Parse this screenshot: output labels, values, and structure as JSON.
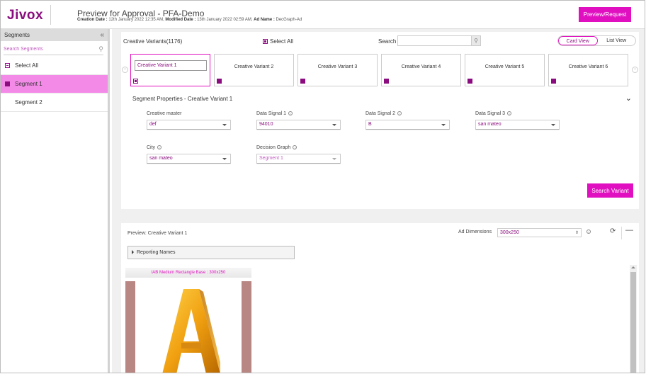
{
  "header": {
    "logo": "Jivox",
    "title": "Preview for Approval - PFA-Demo",
    "creation_label": "Creation Date :",
    "creation_value": "12th January 2022 12:35 AM,",
    "modified_label": "Modified Date :",
    "modified_value": "13th January 2022 02:59 AM,",
    "adname_label": "Ad Name :",
    "adname_value": "DecGraph-Ad",
    "preview_request_label": "Preview/Request"
  },
  "sidebar": {
    "title": "Segments",
    "collapse_icon": "«",
    "search_placeholder": "Search Segments",
    "items": [
      {
        "label": "Select All"
      },
      {
        "label": "Segment 1"
      },
      {
        "label": "Segment 2"
      }
    ]
  },
  "variants": {
    "title": "Creative Variants(1176)",
    "select_all_label": "Select All",
    "search_label": "Search",
    "search_value": "",
    "card_view_label": "Card View",
    "list_view_label": "List View",
    "prev_icon": "‹",
    "next_icon": "›",
    "cards": [
      {
        "label": "Creative Variant 1"
      },
      {
        "label": "Creative Variant 2"
      },
      {
        "label": "Creative Variant 3"
      },
      {
        "label": "Creative Variant 4"
      },
      {
        "label": "Creative Variant 5"
      },
      {
        "label": "Creative Variant 6"
      }
    ]
  },
  "properties": {
    "title": "Segment Properties  - Creative Variant 1",
    "chevron_icon": "⌄",
    "info_icon": "i",
    "fields": [
      {
        "label": "Creative master",
        "value": "def"
      },
      {
        "label": "Data Signal 1",
        "value": "94010"
      },
      {
        "label": "Data Signal 2",
        "value": "B"
      },
      {
        "label": "Data Signal 3",
        "value": "san mateo"
      },
      {
        "label": "City",
        "value": "san mateo"
      },
      {
        "label": "Decision Graph",
        "value": "Segment 1"
      }
    ],
    "search_variant_label": "Search Variant"
  },
  "preview": {
    "title": "Preview: Creative Variant 1",
    "ad_dimensions_label": "Ad Dimensions",
    "ad_dimensions_value": "300x250",
    "updown_icon": "⇕",
    "refresh_icon": "⟳",
    "minimize_icon": "—",
    "reporting_label": "Reporting Names",
    "ad_title": "IAB Medium Rectangle Base : 300x250"
  },
  "colors": {
    "brand": "#8a0c7e",
    "accent": "#e010c0",
    "active_segment": "#f48ae8"
  }
}
